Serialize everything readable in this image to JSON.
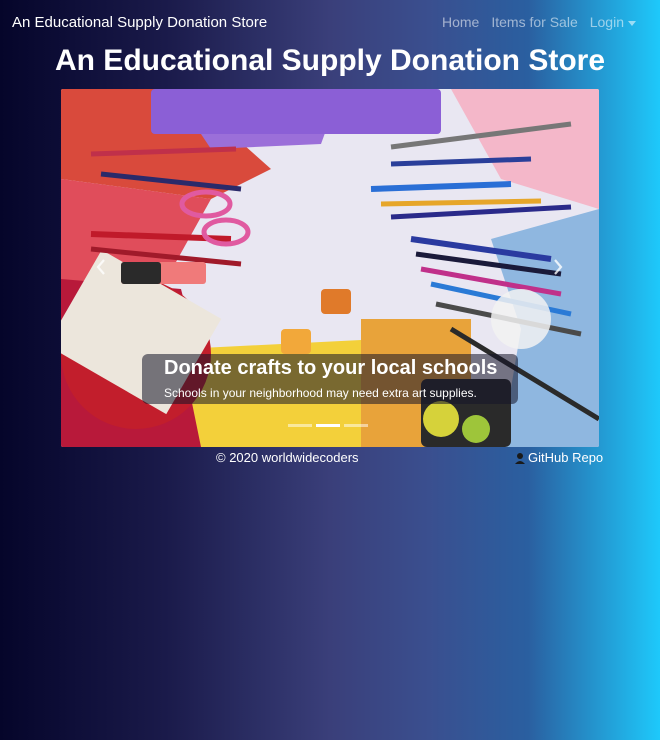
{
  "navbar": {
    "brand": "An Educational Supply Donation Store",
    "links": [
      {
        "label": "Home"
      },
      {
        "label": "Items for Sale"
      },
      {
        "label": "Login"
      }
    ]
  },
  "page": {
    "title": "An Educational Supply Donation Store"
  },
  "carousel": {
    "slide": {
      "title": "Donate crafts to your local schools",
      "subtitle": "Schools in your neighborhood may need extra art supplies."
    },
    "slide_count": 3,
    "active_index": 1,
    "prev_icon": "chevron-left-icon",
    "next_icon": "chevron-right-icon"
  },
  "footer": {
    "copyright": "© 2020 worldwidecoders",
    "repo_link": "GitHub Repo",
    "repo_icon": "person-icon"
  }
}
